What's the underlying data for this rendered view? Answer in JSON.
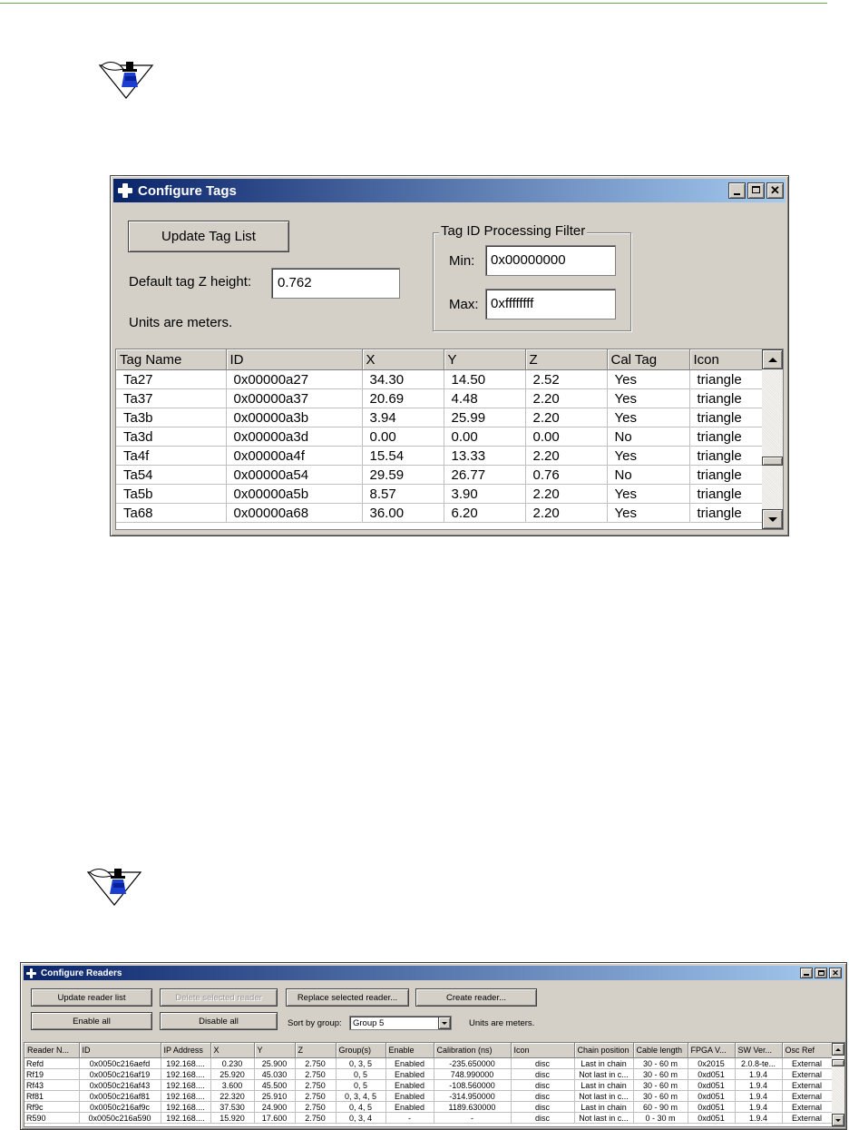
{
  "colors": {
    "title_start": "#0a246a",
    "title_end": "#a6caf0",
    "face": "#d4d0c8",
    "rule": "#6aa84f"
  },
  "icons": {
    "note": "note-quill-icon",
    "app": "cross-app-icon"
  },
  "tags_window": {
    "title": "Configure Tags",
    "update_button": "Update Tag List",
    "z_label": "Default tag Z height:",
    "z_value": "0.762",
    "units_note": "Units are meters.",
    "filter_group": "Tag ID Processing Filter",
    "min_label": "Min:",
    "min_value": "0x00000000",
    "max_label": "Max:",
    "max_value": "0xffffffff",
    "columns": [
      "Tag Name",
      "ID",
      "X",
      "Y",
      "Z",
      "Cal Tag",
      "Icon"
    ],
    "rows": [
      [
        "Ta27",
        "0x00000a27",
        "34.30",
        "14.50",
        "2.52",
        "Yes",
        "triangle"
      ],
      [
        "Ta37",
        "0x00000a37",
        "20.69",
        "4.48",
        "2.20",
        "Yes",
        "triangle"
      ],
      [
        "Ta3b",
        "0x00000a3b",
        "3.94",
        "25.99",
        "2.20",
        "Yes",
        "triangle"
      ],
      [
        "Ta3d",
        "0x00000a3d",
        "0.00",
        "0.00",
        "0.00",
        "No",
        "triangle"
      ],
      [
        "Ta4f",
        "0x00000a4f",
        "15.54",
        "13.33",
        "2.20",
        "Yes",
        "triangle"
      ],
      [
        "Ta54",
        "0x00000a54",
        "29.59",
        "26.77",
        "0.76",
        "No",
        "triangle"
      ],
      [
        "Ta5b",
        "0x00000a5b",
        "8.57",
        "3.90",
        "2.20",
        "Yes",
        "triangle"
      ],
      [
        "Ta68",
        "0x00000a68",
        "36.00",
        "6.20",
        "2.20",
        "Yes",
        "triangle"
      ]
    ]
  },
  "readers_window": {
    "title": "Configure Readers",
    "update_button": "Update reader list",
    "delete_button": "Delete selected reader",
    "replace_button": "Replace selected reader...",
    "create_button": "Create reader...",
    "enable_all": "Enable all",
    "disable_all": "Disable all",
    "sort_label": "Sort by group:",
    "sort_value": "Group 5",
    "units_note": "Units are meters.",
    "columns": [
      "Reader N...",
      "ID",
      "IP Address",
      "X",
      "Y",
      "Z",
      "Group(s)",
      "Enable",
      "Calibration (ns)",
      "Icon",
      "Chain position",
      "Cable length",
      "FPGA V...",
      "SW Ver...",
      "Osc Ref"
    ],
    "rows": [
      [
        "Refd",
        "0x0050c216aefd",
        "192.168....",
        "0.230",
        "25.900",
        "2.750",
        "0, 3, 5",
        "Enabled",
        "-235.650000",
        "disc",
        "Last in chain",
        "30 - 60 m",
        "0x2015",
        "2.0.8-te...",
        "External"
      ],
      [
        "Rf19",
        "0x0050c216af19",
        "192.168....",
        "25.920",
        "45.030",
        "2.750",
        "0, 5",
        "Enabled",
        "748.990000",
        "disc",
        "Not last in c...",
        "30 - 60 m",
        "0xd051",
        "1.9.4",
        "External"
      ],
      [
        "Rf43",
        "0x0050c216af43",
        "192.168....",
        "3.600",
        "45.500",
        "2.750",
        "0, 5",
        "Enabled",
        "-108.560000",
        "disc",
        "Last in chain",
        "30 - 60 m",
        "0xd051",
        "1.9.4",
        "External"
      ],
      [
        "Rf81",
        "0x0050c216af81",
        "192.168....",
        "22.320",
        "25.910",
        "2.750",
        "0, 3, 4, 5",
        "Enabled",
        "-314.950000",
        "disc",
        "Not last in c...",
        "30 - 60 m",
        "0xd051",
        "1.9.4",
        "External"
      ],
      [
        "Rf9c",
        "0x0050c216af9c",
        "192.168....",
        "37.530",
        "24.900",
        "2.750",
        "0, 4, 5",
        "Enabled",
        "1189.630000",
        "disc",
        "Last in chain",
        "60 - 90 m",
        "0xd051",
        "1.9.4",
        "External"
      ],
      [
        "R590",
        "0x0050c216a590",
        "192.168....",
        "15.920",
        "17.600",
        "2.750",
        "0, 3, 4",
        "-",
        "-",
        "disc",
        "Not last in c...",
        "0 - 30 m",
        "0xd051",
        "1.9.4",
        "External"
      ]
    ]
  }
}
